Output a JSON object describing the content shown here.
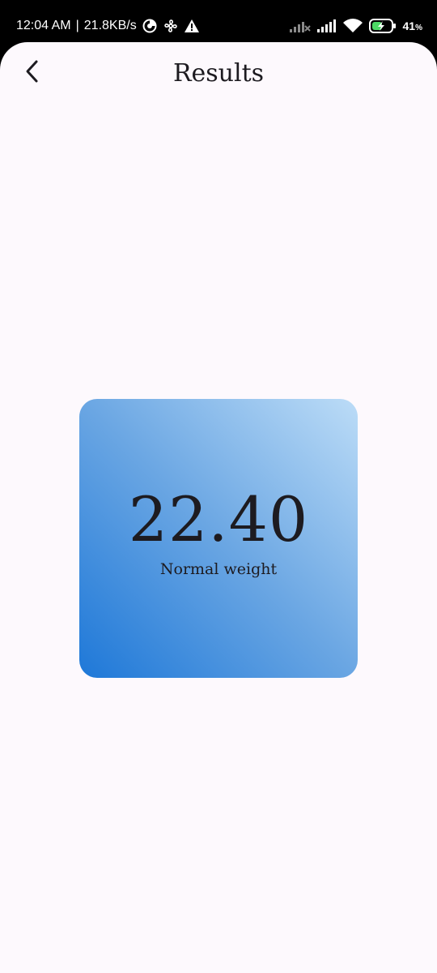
{
  "status_bar": {
    "time": "12:04 AM",
    "separator": "|",
    "speed": "21.8KB/s",
    "battery_level": "41",
    "battery_unit": "%",
    "icons": [
      "data-saver-icon",
      "fan-icon",
      "warning-icon",
      "signal-no-service-icon",
      "signal-icon",
      "wifi-icon",
      "battery-charging-icon"
    ]
  },
  "app_bar": {
    "title": "Results",
    "back_icon": "chevron-left-icon"
  },
  "result": {
    "value": "22.40",
    "category": "Normal weight"
  },
  "colors": {
    "background": "#fdf9fd",
    "card_gradient_start": "#1e78d8",
    "card_gradient_end": "#bcdcf7",
    "text": "#1d1b20"
  }
}
